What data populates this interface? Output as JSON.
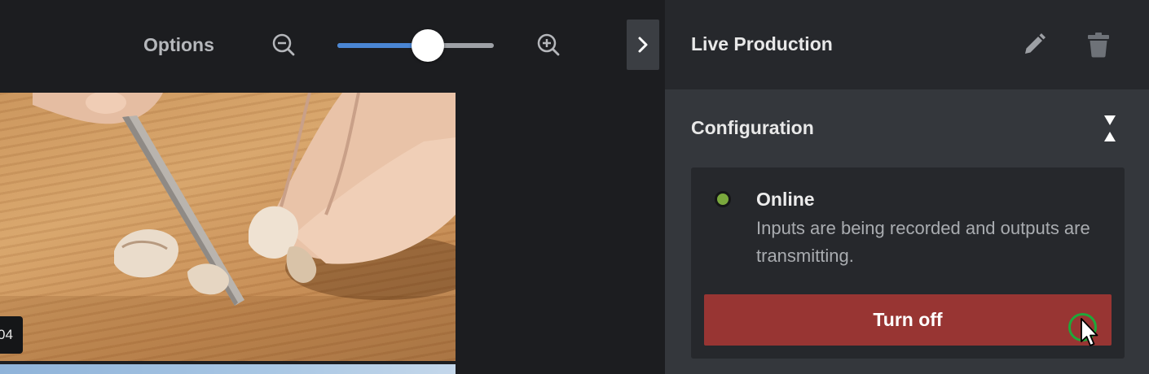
{
  "toolbar": {
    "options_label": "Options",
    "zoom_level": 0.58
  },
  "preview": {
    "timecode": "04"
  },
  "panel": {
    "title": "Live Production",
    "section_title": "Configuration",
    "status": {
      "title": "Online",
      "description": "Inputs are being recorded and outputs are transmitting.",
      "color": "#7aa83d"
    },
    "turn_off_label": "Turn off"
  },
  "colors": {
    "accent_blue": "#4a86d4",
    "danger_red": "#983533",
    "click_ring": "#1fa83a"
  },
  "icons": [
    "zoom-out-icon",
    "zoom-in-icon",
    "chevron-right-icon",
    "pencil-icon",
    "trash-icon",
    "collapse-expand-icon",
    "cursor-icon"
  ]
}
